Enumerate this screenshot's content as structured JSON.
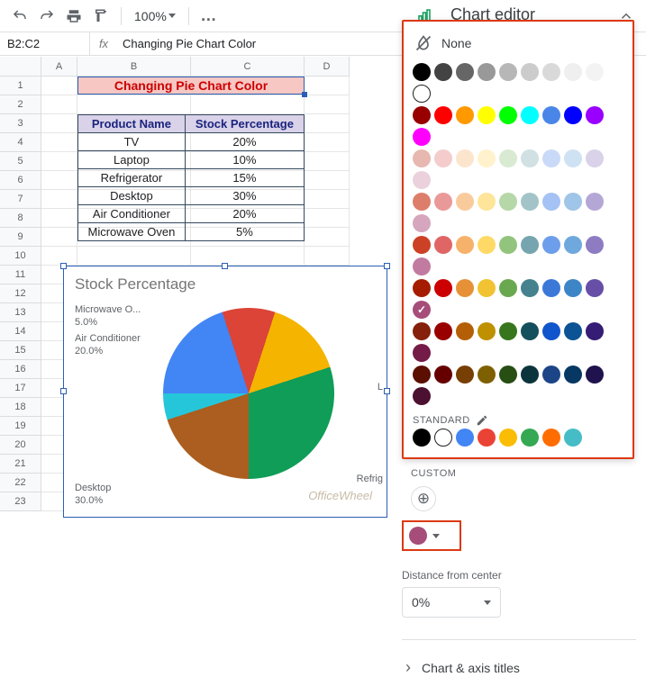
{
  "toolbar": {
    "zoom_value": "100%",
    "icons": {
      "undo": "undo",
      "redo": "redo",
      "print": "print",
      "paint": "paint-format",
      "more": "more",
      "collapse": "collapse"
    }
  },
  "formula_bar": {
    "name_box": "B2:C2",
    "fx_label": "fx",
    "formula_value": "Changing Pie Chart Color"
  },
  "columns": [
    "A",
    "B",
    "C",
    "D"
  ],
  "row_numbers": [
    1,
    2,
    3,
    4,
    5,
    6,
    7,
    8,
    9,
    10,
    11,
    12,
    13,
    14,
    15,
    16,
    17,
    18,
    19,
    20,
    21,
    22,
    23
  ],
  "title_cell": "Changing Pie Chart Color",
  "table": {
    "headers": [
      "Product Name",
      "Stock Percentage"
    ],
    "rows": [
      [
        "TV",
        "20%"
      ],
      [
        "Laptop",
        "10%"
      ],
      [
        "Refrigerator",
        "15%"
      ],
      [
        "Desktop",
        "30%"
      ],
      [
        "Air Conditioner",
        "20%"
      ],
      [
        "Microwave Oven",
        "5%"
      ]
    ]
  },
  "chart": {
    "title": "Stock Percentage",
    "labels": {
      "microwave": {
        "name": "Microwave O...",
        "value": "5.0%"
      },
      "ac": {
        "name": "Air Conditioner",
        "value": "20.0%"
      },
      "desktop": {
        "name": "Desktop",
        "value": "30.0%"
      },
      "refrigerator": {
        "name": "Refrig",
        "value": ""
      },
      "laptop": {
        "name": "L",
        "value": ""
      }
    }
  },
  "chart_data": {
    "type": "pie",
    "title": "Stock Percentage",
    "categories": [
      "TV",
      "Laptop",
      "Refrigerator",
      "Desktop",
      "Air Conditioner",
      "Microwave Oven"
    ],
    "values": [
      20,
      10,
      15,
      30,
      20,
      5
    ],
    "colors": [
      "#4285f4",
      "#db4437",
      "#f4b400",
      "#0f9d58",
      "#ab5e1f",
      "#26c6da"
    ]
  },
  "chart_editor": {
    "title": "Chart editor",
    "color_picker": {
      "none_label": "None",
      "standard_label": "STANDARD",
      "custom_label": "CUSTOM",
      "selected_color": "#a64d79",
      "grayscale": [
        "#000000",
        "#434343",
        "#666666",
        "#999999",
        "#b7b7b7",
        "#cccccc",
        "#d9d9d9",
        "#efefef",
        "#f3f3f3",
        "#ffffff"
      ],
      "primary": [
        "#980000",
        "#ff0000",
        "#ff9900",
        "#ffff00",
        "#00ff00",
        "#00ffff",
        "#4a86e8",
        "#0000ff",
        "#9900ff",
        "#ff00ff"
      ],
      "light3": [
        "#e6b8af",
        "#f4cccc",
        "#fce5cd",
        "#fff2cc",
        "#d9ead3",
        "#d0e0e3",
        "#c9daf8",
        "#cfe2f3",
        "#d9d2e9",
        "#ead1dc"
      ],
      "light2": [
        "#dd7e6b",
        "#ea9999",
        "#f9cb9c",
        "#ffe599",
        "#b6d7a8",
        "#a2c4c9",
        "#a4c2f4",
        "#9fc5e8",
        "#b4a7d6",
        "#d5a6bd"
      ],
      "light1": [
        "#cc4125",
        "#e06666",
        "#f6b26b",
        "#ffd966",
        "#93c47d",
        "#76a5af",
        "#6d9eeb",
        "#6fa8dc",
        "#8e7cc3",
        "#c27ba0"
      ],
      "dark1": [
        "#a61c00",
        "#cc0000",
        "#e69138",
        "#f1c232",
        "#6aa84f",
        "#45818e",
        "#3c78d8",
        "#3d85c6",
        "#674ea7",
        "#a64d79"
      ],
      "dark2": [
        "#85200c",
        "#990000",
        "#b45f06",
        "#bf9000",
        "#38761d",
        "#134f5c",
        "#1155cc",
        "#0b5394",
        "#351c75",
        "#741b47"
      ],
      "dark3": [
        "#5b0f00",
        "#660000",
        "#783f04",
        "#7f6000",
        "#274e13",
        "#0c343d",
        "#1c4587",
        "#073763",
        "#20124d",
        "#4c1130"
      ],
      "standard": [
        "#000000",
        "#ffffff",
        "#4285f4",
        "#ea4335",
        "#fbbc04",
        "#34a853",
        "#ff6d01",
        "#46bdc6"
      ]
    },
    "distance_label": "Distance from center",
    "distance_value": "0%",
    "section_titles": "Chart & axis titles"
  },
  "watermark": "OfficeWheel"
}
